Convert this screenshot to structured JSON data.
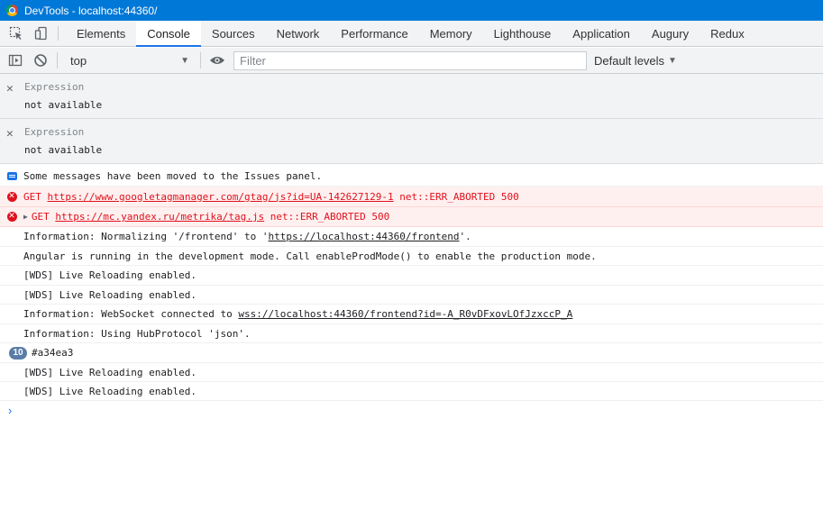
{
  "window": {
    "title": "DevTools - localhost:44360/"
  },
  "tabs": [
    {
      "label": "Elements",
      "active": false
    },
    {
      "label": "Console",
      "active": true
    },
    {
      "label": "Sources",
      "active": false
    },
    {
      "label": "Network",
      "active": false
    },
    {
      "label": "Performance",
      "active": false
    },
    {
      "label": "Memory",
      "active": false
    },
    {
      "label": "Lighthouse",
      "active": false
    },
    {
      "label": "Application",
      "active": false
    },
    {
      "label": "Augury",
      "active": false
    },
    {
      "label": "Redux",
      "active": false
    }
  ],
  "toolbar": {
    "context": "top",
    "filter_placeholder": "Filter",
    "levels_label": "Default levels"
  },
  "expressions": [
    {
      "label": "Expression",
      "value": "not available"
    },
    {
      "label": "Expression",
      "value": "not available"
    }
  ],
  "messages": {
    "issues": "Some messages have been moved to the Issues panel.",
    "err1": {
      "method": "GET",
      "url": "https://www.googletagmanager.com/gtag/js?id=UA-142627129-1",
      "status": "net::ERR_ABORTED 500"
    },
    "err2": {
      "method": "GET",
      "url": "https://mc.yandex.ru/metrika/tag.js",
      "status": "net::ERR_ABORTED 500"
    },
    "normalizing_pre": "Information: Normalizing '/frontend' to '",
    "normalizing_url": "https://localhost:44360/frontend",
    "normalizing_post": "'.",
    "angular": "Angular is running in the development mode. Call enableProdMode() to enable the production mode.",
    "wds1": "[WDS] Live Reloading enabled.",
    "wds2": "[WDS] Live Reloading enabled.",
    "ws_pre": "Information: WebSocket connected to ",
    "ws_url": "wss://localhost:44360/frontend?id=-A_R0vDFxovLOfJzxccP_A",
    "hub": "Information: Using HubProtocol 'json'.",
    "repeat_count": "10",
    "repeat_text": "#a34ea3",
    "wds3": "[WDS] Live Reloading enabled.",
    "wds4": "[WDS] Live Reloading enabled."
  },
  "prompt_glyph": "›",
  "colors": {
    "accent": "#1a73e8",
    "error": "#e0111b",
    "titlebar": "#0078d7"
  }
}
